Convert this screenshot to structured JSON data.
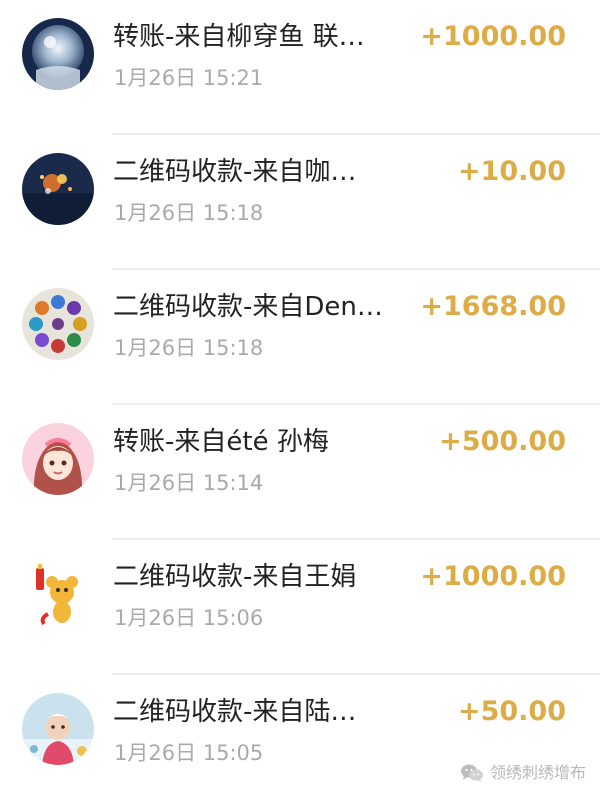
{
  "transactions": [
    {
      "title": "转账-来自柳穿鱼 联…",
      "time": "1月26日 15:21",
      "amount": "+1000.00",
      "avatar": "frozen-bubble-avatar"
    },
    {
      "title": "二维码收款-来自咖…",
      "time": "1月26日 15:18",
      "amount": "+10.00",
      "avatar": "night-lights-avatar"
    },
    {
      "title": "二维码收款-来自Den…",
      "time": "1月26日 15:18",
      "amount": "+1668.00",
      "avatar": "bead-bracelet-avatar"
    },
    {
      "title": "转账-来自été 孙梅",
      "time": "1月26日 15:14",
      "amount": "+500.00",
      "avatar": "cartoon-girl-avatar"
    },
    {
      "title": "二维码收款-来自王娟",
      "time": "1月26日 15:06",
      "amount": "+1000.00",
      "avatar": "cartoon-mouse-avatar"
    },
    {
      "title": "二维码收款-来自陆…",
      "time": "1月26日 15:05",
      "amount": "+50.00",
      "avatar": "child-photo-avatar"
    }
  ],
  "watermark": {
    "text": "领绣刺绣增布",
    "icon": "wechat-icon"
  },
  "colors": {
    "amount": "#dcac46",
    "title": "#222222",
    "time": "#aaaaaa",
    "divider": "#eeeeee"
  }
}
